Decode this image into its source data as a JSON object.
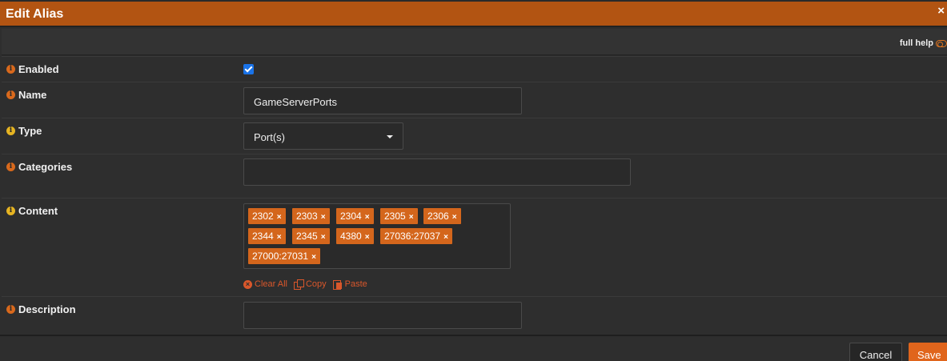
{
  "dialog": {
    "title": "Edit Alias",
    "close": "×"
  },
  "help": {
    "label": "full help"
  },
  "fields": {
    "enabled": {
      "label": "Enabled",
      "checked": true
    },
    "name": {
      "label": "Name",
      "value": "GameServerPorts"
    },
    "type": {
      "label": "Type",
      "value": "Port(s)"
    },
    "categories": {
      "label": "Categories",
      "value": ""
    },
    "content": {
      "label": "Content",
      "tags": [
        "2302",
        "2303",
        "2304",
        "2305",
        "2306",
        "2344",
        "2345",
        "4380",
        "27036:27037",
        "27000:27031"
      ],
      "remove_glyph": "×",
      "actions": {
        "clear_all": "Clear All",
        "copy": "Copy",
        "paste": "Paste"
      }
    },
    "description": {
      "label": "Description",
      "value": ""
    }
  },
  "footer": {
    "cancel": "Cancel",
    "save": "Save"
  },
  "colors": {
    "accent": "#b25412",
    "tag": "#d4661c",
    "checkbox": "#1a73e8"
  }
}
